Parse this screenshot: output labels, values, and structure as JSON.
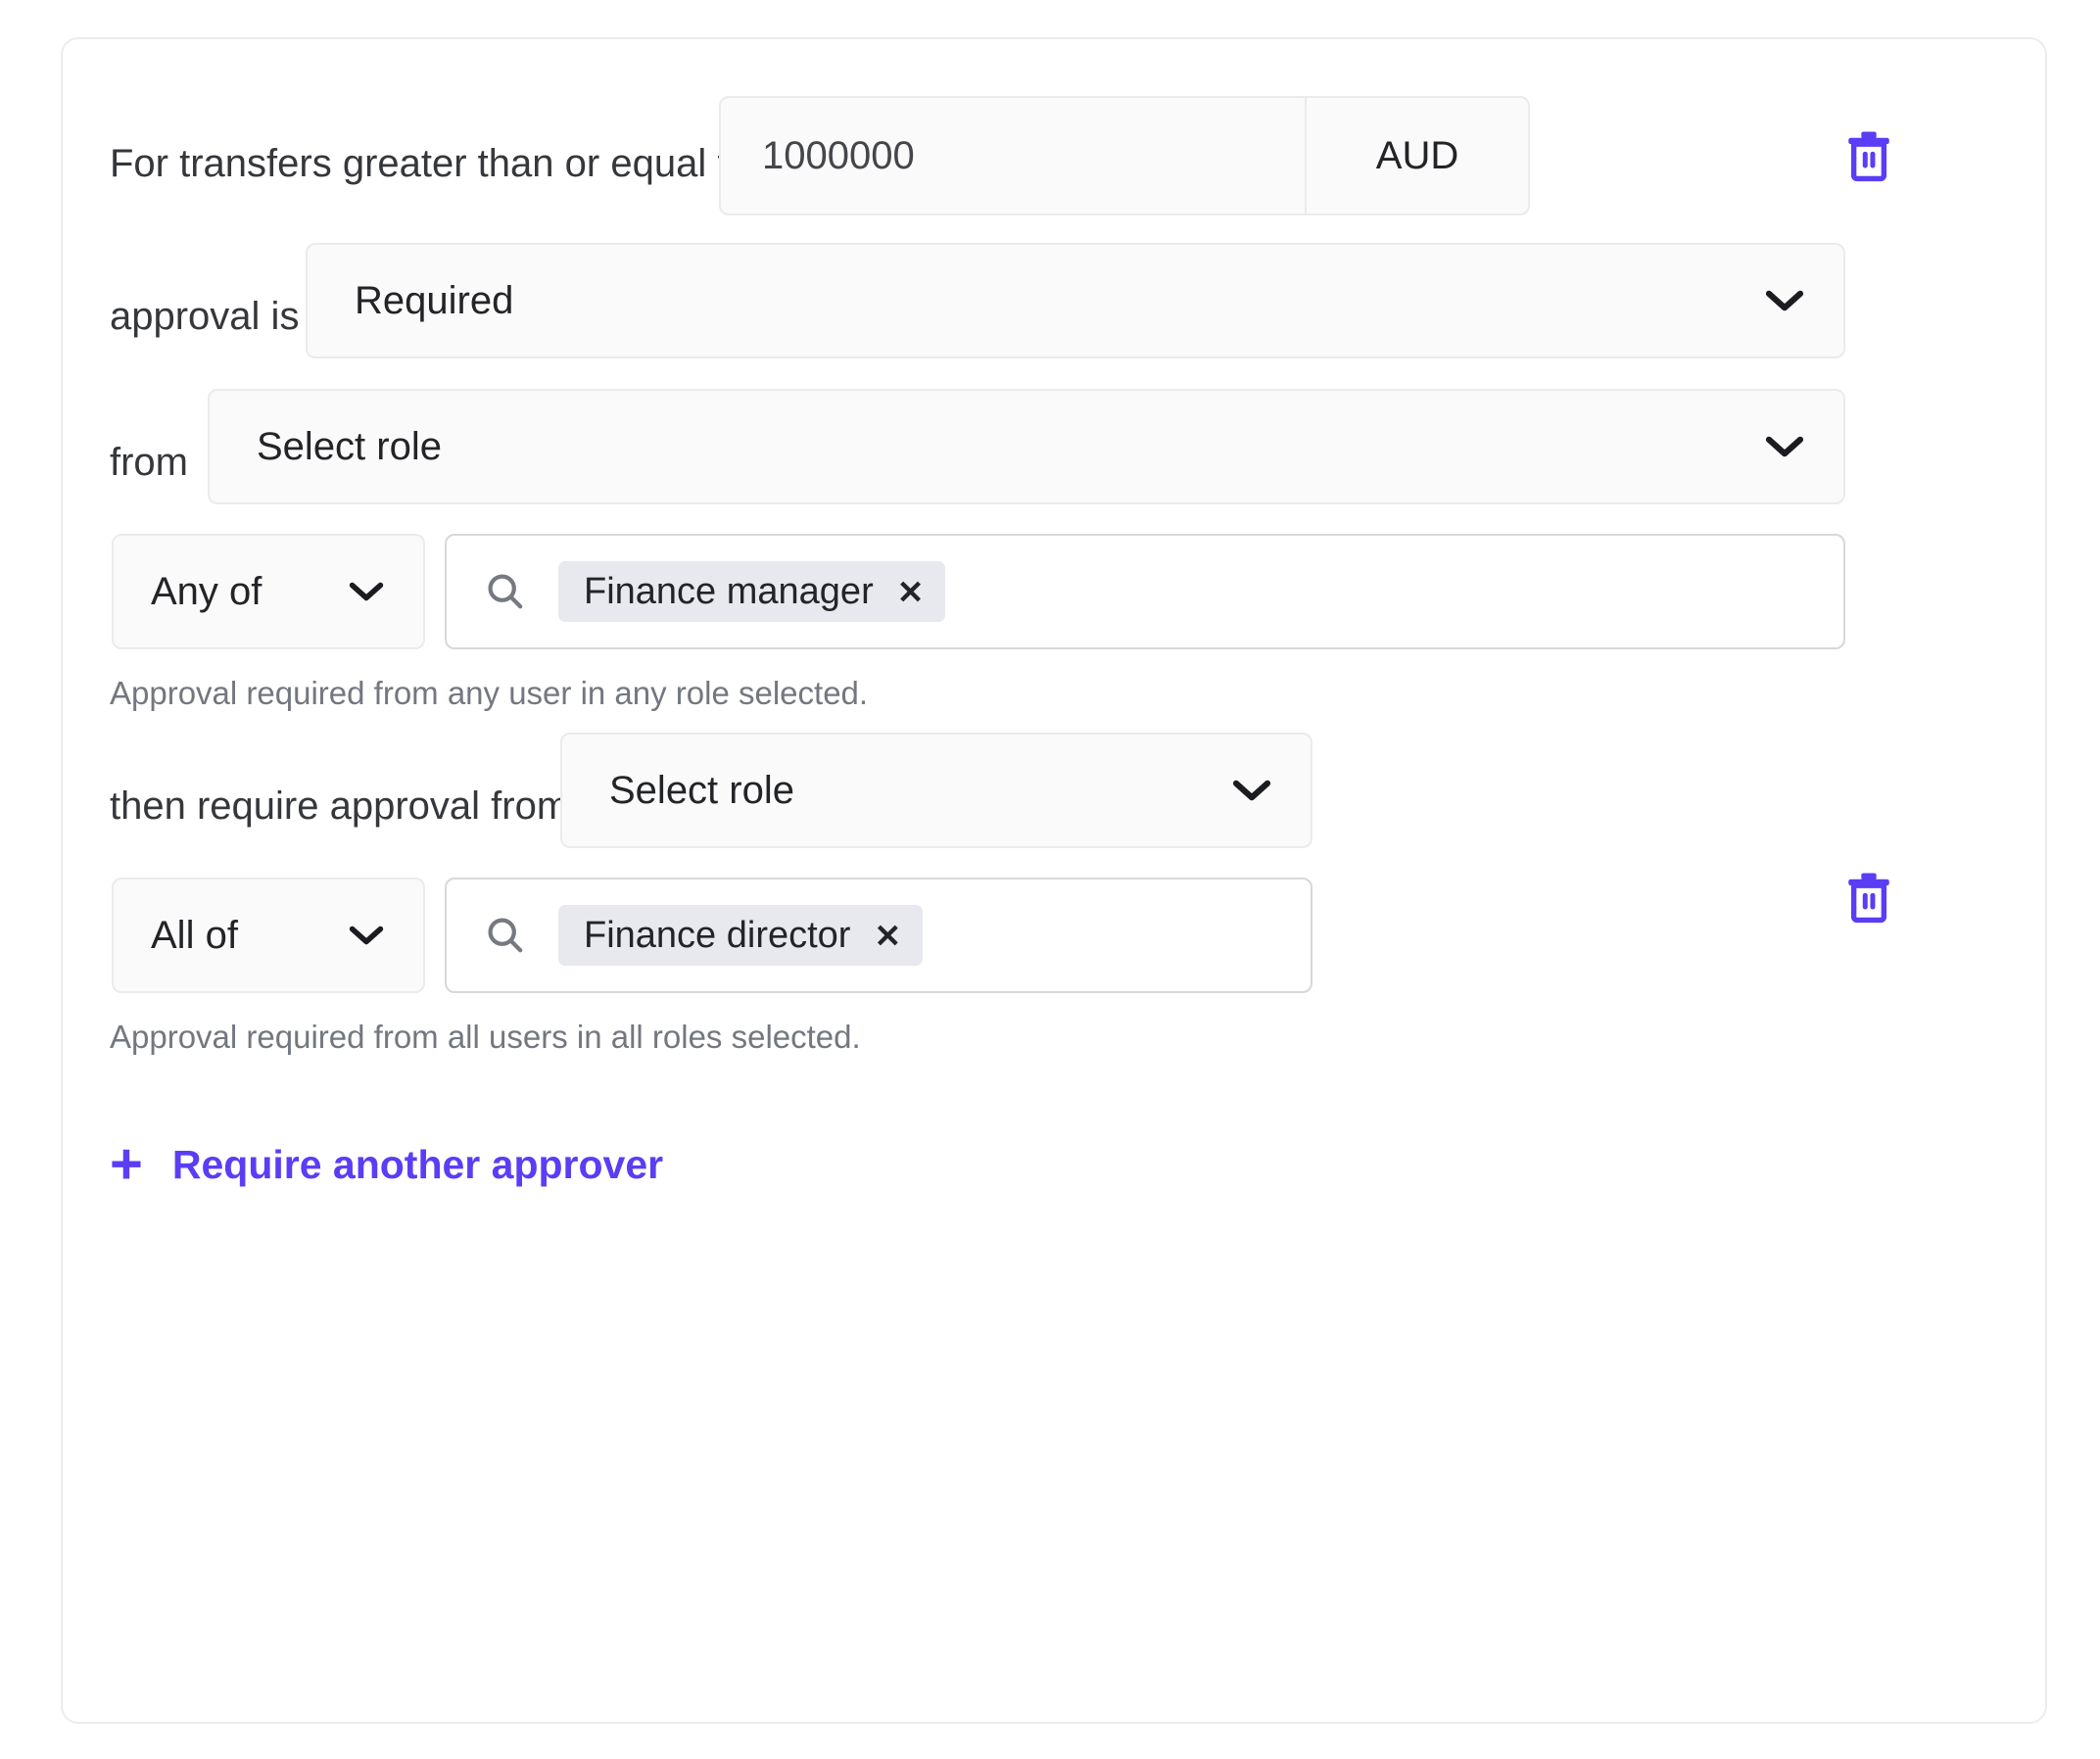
{
  "theme": {
    "accent": "#5b3df5",
    "field_bg": "#fafafa",
    "field_border": "#e9ebee",
    "chip_bg": "#e7e9ee",
    "helper_text": "#74777f",
    "card_border": "#eaecef"
  },
  "rule": {
    "threshold_label": "For transfers greater than or equal to",
    "amount_value": "1000000",
    "currency": "AUD",
    "delete_rule_icon": "trash-icon",
    "approval_is_label": "approval is",
    "approval_is_value": "Required",
    "from_label": "from",
    "from_value": "Select role",
    "approver_1": {
      "match_mode": "Any of",
      "search_icon": "search-icon",
      "chips": [
        {
          "label": "Finance manager",
          "remove_icon": "close-icon"
        }
      ],
      "helper": "Approval required from any user in any role selected."
    },
    "then_label": "then require approval from",
    "then_value": "Select role",
    "approver_2": {
      "match_mode": "All of",
      "search_icon": "search-icon",
      "chips": [
        {
          "label": "Finance director",
          "remove_icon": "close-icon"
        }
      ],
      "helper": "Approval required from all users in all roles selected.",
      "delete_icon": "trash-icon"
    },
    "add_approver": {
      "plus": "+",
      "label": "Require another approver"
    },
    "chevron_icon": "chevron-down-icon"
  }
}
